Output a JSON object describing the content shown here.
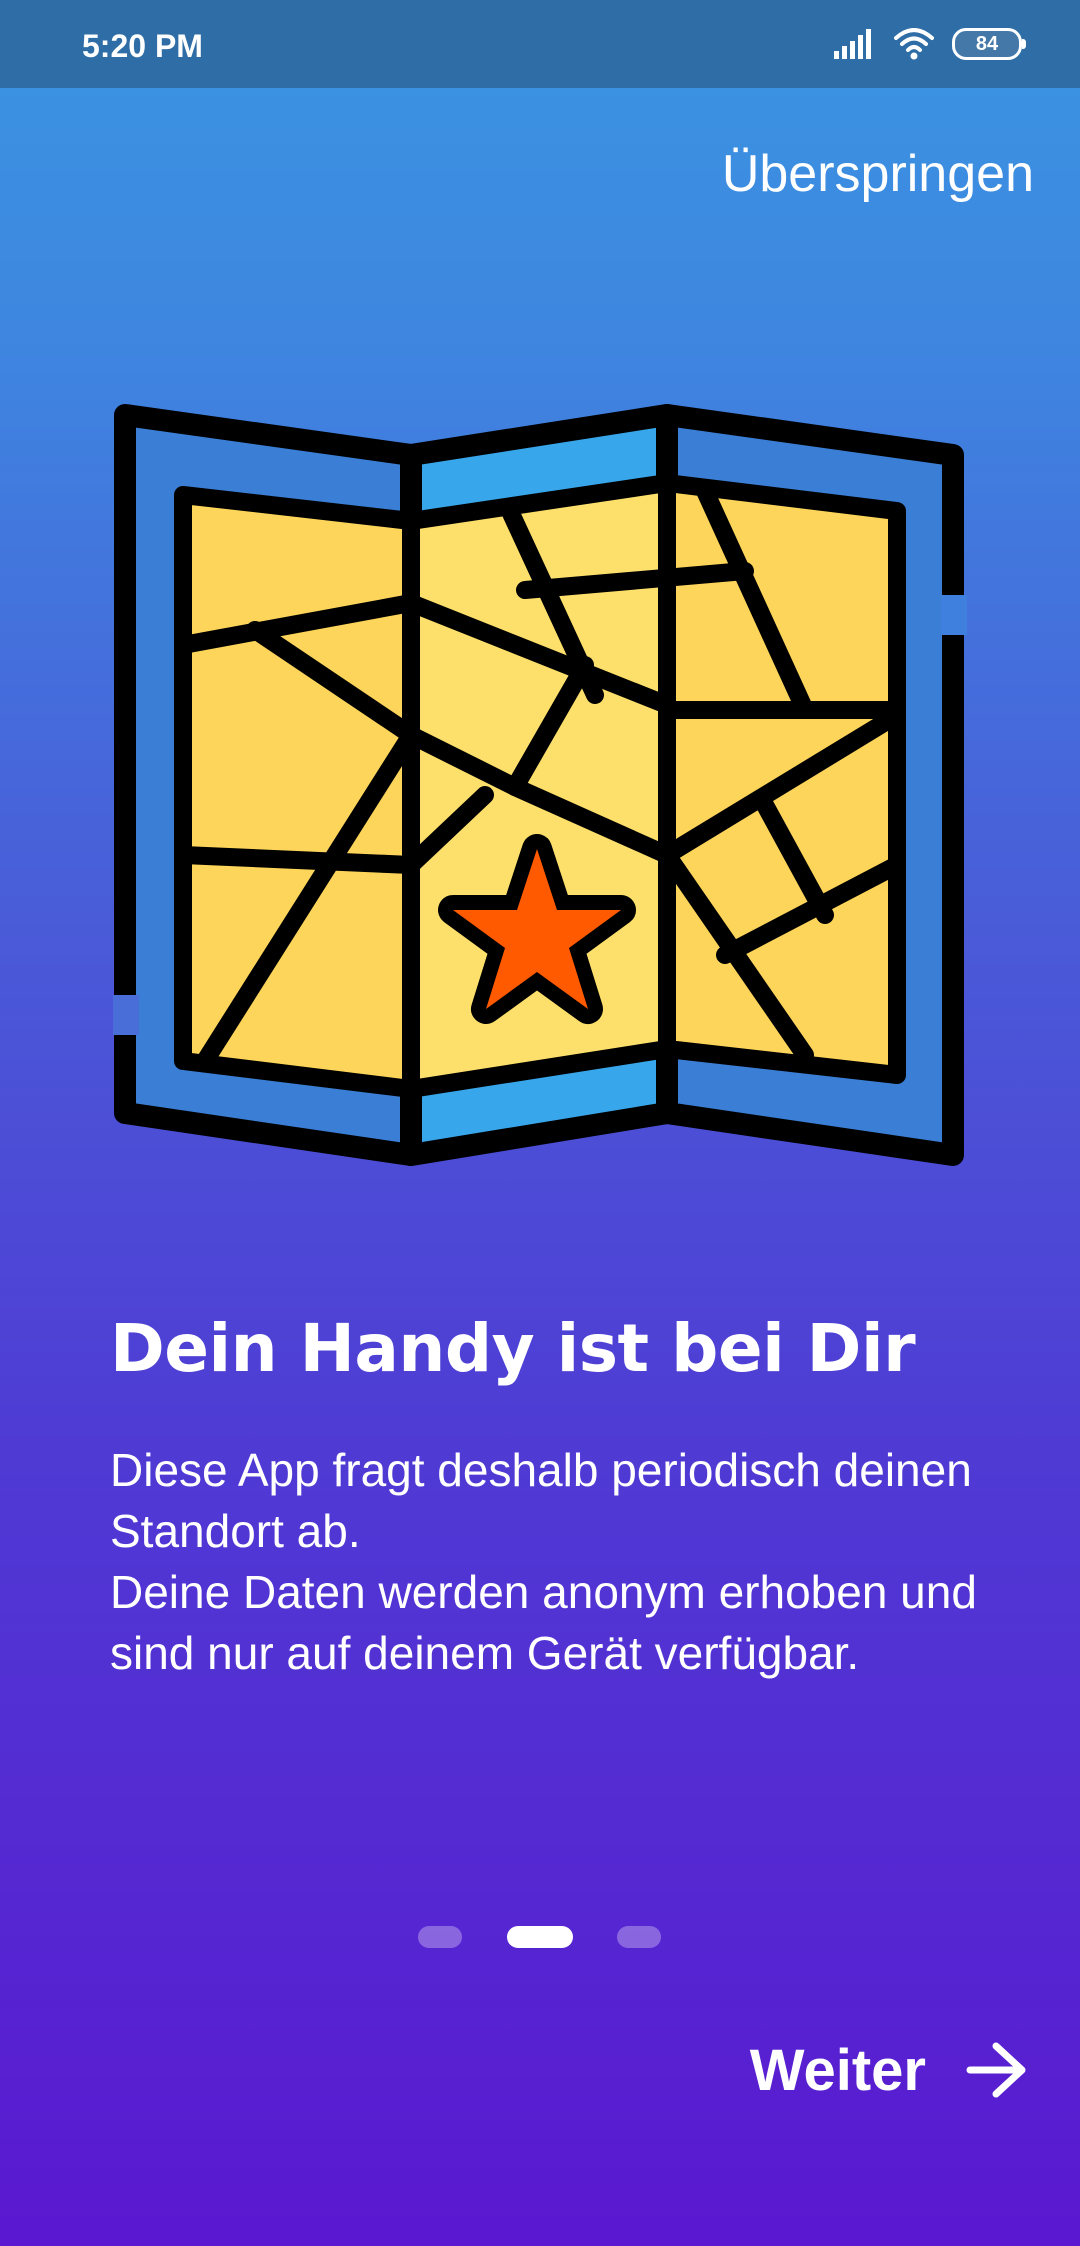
{
  "status_bar": {
    "time": "5:20 PM",
    "battery": "84",
    "icons": [
      "signal-icon",
      "wifi-icon",
      "battery-icon"
    ]
  },
  "skip_label": "Überspringen",
  "illustration_icon": "folded-map-with-star-icon",
  "title": "Dein Handy ist bei Dir",
  "description": "Diese App fragt deshalb periodisch deinen Standort ab.\nDeine Daten werden anonym erhoben und sind nur auf deinem Gerät verfügbar.",
  "pager": {
    "total": 3,
    "active_index": 1
  },
  "next_label": "Weiter",
  "next_icon": "arrow-right-icon",
  "colors": {
    "gradient_top": "#3a95e2",
    "gradient_bottom": "#5a18d0",
    "map_yellow": "#fdd55a",
    "map_blue": "#3a7fd5",
    "star_orange": "#ff5a00"
  }
}
